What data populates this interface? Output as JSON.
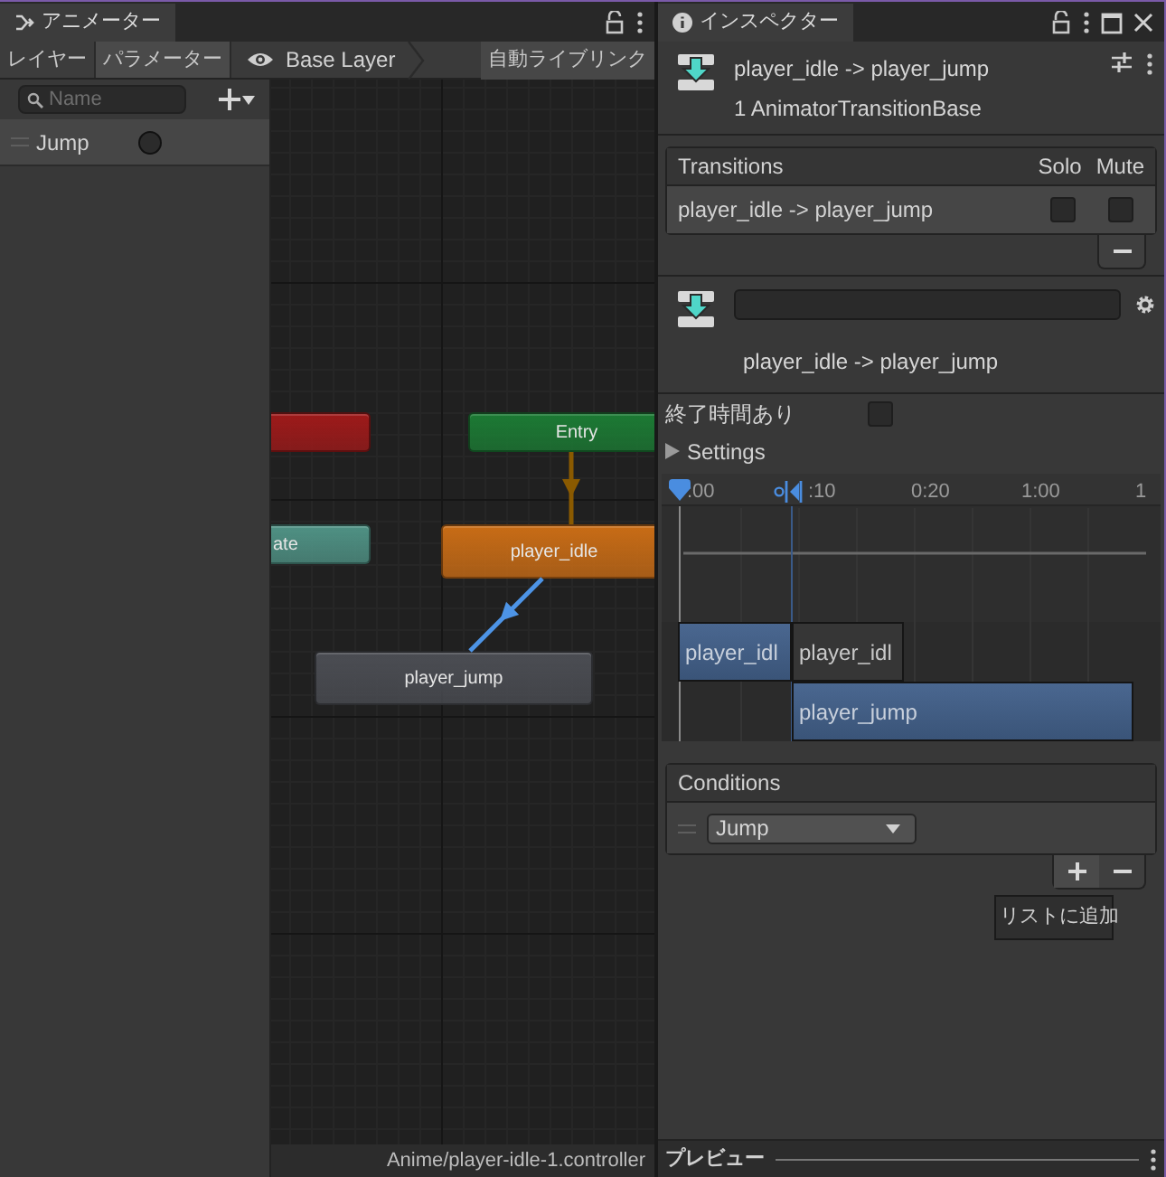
{
  "animator": {
    "tab": {
      "title": "アニメーター"
    },
    "mode_tabs": [
      {
        "label": "レイヤー",
        "selected": false
      },
      {
        "label": "パラメーター",
        "selected": true
      }
    ],
    "breadcrumb": "Base Layer",
    "live_link_button": "自動ライブリンク",
    "search": {
      "placeholder": "Name"
    },
    "parameters": [
      {
        "name": "Jump",
        "kind": "trigger",
        "value": false
      }
    ],
    "graph": {
      "nodes": [
        {
          "color": "#9e1a1a"
        },
        {
          "label": "Entry",
          "color": "#1c7a34"
        },
        {
          "label": "ate",
          "color": "#4f9184"
        },
        {
          "label": "player_idle",
          "color": "#c86c16"
        },
        {
          "label": "player_jump",
          "color": "#4b4d53"
        }
      ],
      "transitions": [
        {
          "color": "#8a5a00"
        },
        {
          "color": "#4d94e6"
        }
      ]
    },
    "status": "Anime/player-idle-1.controller"
  },
  "inspector": {
    "tab": {
      "title": "インスペクター"
    },
    "title": "player_idle -> player_jump",
    "subtitle": "1 AnimatorTransitionBase",
    "transitions_list": {
      "header": "Transitions",
      "columns": [
        "Solo",
        "Mute"
      ],
      "rows": [
        {
          "name": "player_idle -> player_jump",
          "solo": false,
          "mute": false
        }
      ]
    },
    "transition_name": "player_idle -> player_jump",
    "has_exit_time": {
      "label": "終了時間あり",
      "checked": false
    },
    "settings": {
      "label": "Settings",
      "expanded": false
    },
    "timeline": {
      "ruler": [
        ":00",
        ":10",
        "0:20",
        "1:00",
        "1"
      ],
      "clips": [
        {
          "label": "player_idl",
          "kind": "source"
        },
        {
          "label": "player_idl",
          "kind": "source-tail"
        },
        {
          "label": "player_jump",
          "kind": "target"
        }
      ]
    },
    "conditions": {
      "header": "Conditions",
      "rows": [
        {
          "parameter": "Jump"
        }
      ]
    },
    "tooltip": "リストに追加",
    "preview": "プレビュー"
  }
}
